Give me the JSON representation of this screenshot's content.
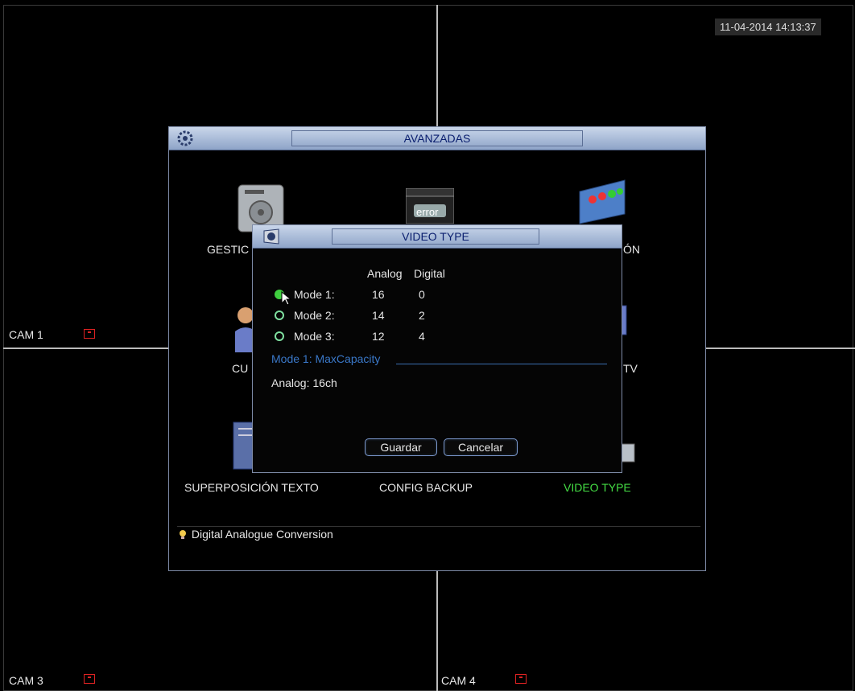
{
  "clock": "11-04-2014 14:13:37",
  "cameras": {
    "cam1": "CAM 1",
    "cam3": "CAM 3",
    "cam4": "CAM 4"
  },
  "window": {
    "title": "AVANZADAS",
    "items": [
      {
        "label": "GESTIC"
      },
      {
        "label": "ÓN"
      },
      {
        "label": "CU"
      },
      {
        "label": "TV"
      },
      {
        "label": "SUPERPOSICIÓN TEXTO"
      },
      {
        "label": "CONFIG BACKUP"
      },
      {
        "label": "VIDEO TYPE"
      }
    ],
    "error_icon_text": "error",
    "hint": "Digital Analogue Conversion",
    "active_color": "#44dd44"
  },
  "dialog": {
    "title": "VIDEO TYPE",
    "headers": {
      "analog": "Analog",
      "digital": "Digital"
    },
    "modes": [
      {
        "label": "Mode 1:",
        "analog": "16",
        "digital": "0",
        "selected": true
      },
      {
        "label": "Mode 2:",
        "analog": "14",
        "digital": "2",
        "selected": false
      },
      {
        "label": "Mode 3:",
        "analog": "12",
        "digital": "4",
        "selected": false
      }
    ],
    "info_title": "Mode 1: MaxCapacity",
    "info_text": "Analog: 16ch",
    "save": "Guardar",
    "cancel": "Cancelar"
  }
}
